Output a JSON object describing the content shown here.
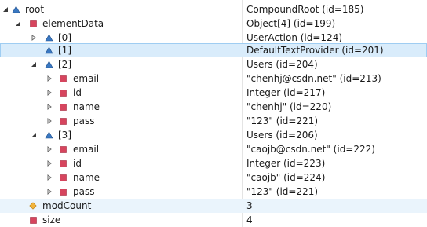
{
  "colors": {
    "selected_bg": "#d9ecfb",
    "triangle_icon": "#3a78c2",
    "square_icon": "#d6455e",
    "diamond_icon": "#f2b33a"
  },
  "rows": [
    {
      "label": "root",
      "value": "CompoundRoot  (id=185)",
      "twist": "expanded",
      "icon": "triangle"
    },
    {
      "label": "elementData",
      "value": "Object[4]  (id=199)",
      "twist": "expanded",
      "icon": "square"
    },
    {
      "label": "[0]",
      "value": "UserAction  (id=124)",
      "twist": "collapsed",
      "icon": "triangle"
    },
    {
      "label": "[1]",
      "value": "DefaultTextProvider  (id=201)",
      "twist": "none",
      "icon": "triangle"
    },
    {
      "label": "[2]",
      "value": "Users  (id=204)",
      "twist": "expanded",
      "icon": "triangle"
    },
    {
      "label": "email",
      "value": "\"chenhj@csdn.net\" (id=213)",
      "twist": "collapsed",
      "icon": "square"
    },
    {
      "label": "id",
      "value": "Integer  (id=217)",
      "twist": "collapsed",
      "icon": "square"
    },
    {
      "label": "name",
      "value": "\"chenhj\" (id=220)",
      "twist": "collapsed",
      "icon": "square"
    },
    {
      "label": "pass",
      "value": "\"123\" (id=221)",
      "twist": "collapsed",
      "icon": "square"
    },
    {
      "label": "[3]",
      "value": "Users  (id=206)",
      "twist": "expanded",
      "icon": "triangle"
    },
    {
      "label": "email",
      "value": "\"caojb@csdn.net\" (id=222)",
      "twist": "collapsed",
      "icon": "square"
    },
    {
      "label": "id",
      "value": "Integer  (id=223)",
      "twist": "collapsed",
      "icon": "square"
    },
    {
      "label": "name",
      "value": "\"caojb\" (id=224)",
      "twist": "collapsed",
      "icon": "square"
    },
    {
      "label": "pass",
      "value": "\"123\" (id=221)",
      "twist": "collapsed",
      "icon": "square"
    },
    {
      "label": "modCount",
      "value": "3",
      "twist": "none",
      "icon": "diamond"
    },
    {
      "label": "size",
      "value": "4",
      "twist": "none",
      "icon": "square"
    }
  ]
}
